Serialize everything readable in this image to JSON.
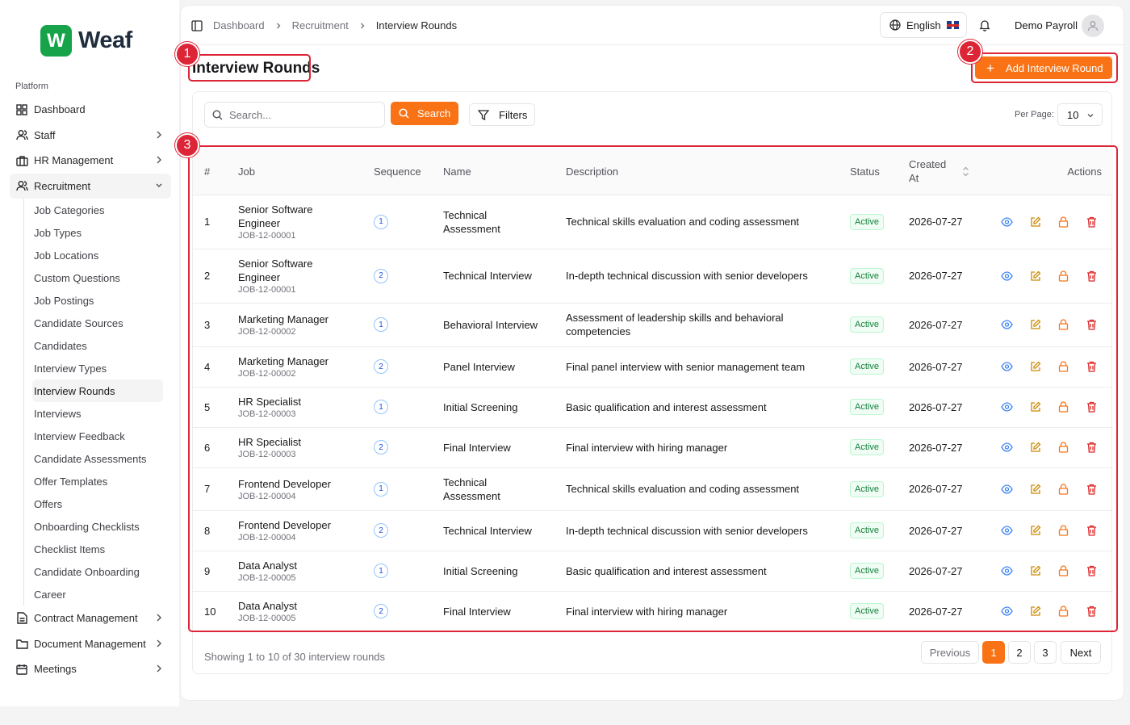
{
  "brand": {
    "logo_letter": "W",
    "name": "Weaf",
    "color": "#16a34a"
  },
  "sidebar": {
    "section_label": "Platform",
    "items": [
      {
        "label": "Dashboard",
        "icon": "grid-icon"
      },
      {
        "label": "Staff",
        "icon": "users-icon"
      },
      {
        "label": "HR Management",
        "icon": "briefcase-icon"
      },
      {
        "label": "Recruitment",
        "icon": "users-icon"
      }
    ],
    "recruitment_children": [
      "Job Categories",
      "Job Types",
      "Job Locations",
      "Custom Questions",
      "Job Postings",
      "Candidate Sources",
      "Candidates",
      "Interview Types",
      "Interview Rounds",
      "Interviews",
      "Interview Feedback",
      "Candidate Assessments",
      "Offer Templates",
      "Offers",
      "Onboarding Checklists",
      "Checklist Items",
      "Candidate Onboarding",
      "Career"
    ],
    "bottom_items": [
      {
        "label": "Contract Management",
        "icon": "file-icon"
      },
      {
        "label": "Document Management",
        "icon": "folder-icon"
      },
      {
        "label": "Meetings",
        "icon": "calendar-icon"
      }
    ]
  },
  "header": {
    "breadcrumbs": [
      "Dashboard",
      "Recruitment",
      "Interview Rounds"
    ],
    "language": "English",
    "user_name": "Demo Payroll"
  },
  "page": {
    "title": "Interview Rounds",
    "add_button": "Add Interview Round",
    "accent_color": "#f97316"
  },
  "filters": {
    "search_placeholder": "Search...",
    "search_button": "Search",
    "filters_button": "Filters",
    "per_page_label": "Per Page:",
    "per_page_value": "10"
  },
  "table": {
    "columns": {
      "idx": "#",
      "job": "Job",
      "sequence": "Sequence",
      "name": "Name",
      "description": "Description",
      "status": "Status",
      "created_line1": "Created",
      "created_line2": "At",
      "actions": "Actions"
    },
    "rows": [
      {
        "idx": "1",
        "job_line1": "Senior Software",
        "job_line2": "Engineer",
        "code": "JOB-12-00001",
        "seq": "1",
        "name_line1": "Technical",
        "name_line2": "Assessment",
        "desc_line1": "Technical skills evaluation and coding assessment",
        "desc_line2": "",
        "status": "Active",
        "created": "2026-07-27"
      },
      {
        "idx": "2",
        "job_line1": "Senior Software",
        "job_line2": "Engineer",
        "code": "JOB-12-00001",
        "seq": "2",
        "name_line1": "Technical Interview",
        "name_line2": "",
        "desc_line1": "In-depth technical discussion with senior developers",
        "desc_line2": "",
        "status": "Active",
        "created": "2026-07-27"
      },
      {
        "idx": "3",
        "job_line1": "Marketing Manager",
        "job_line2": "",
        "code": "JOB-12-00002",
        "seq": "1",
        "name_line1": "Behavioral Interview",
        "name_line2": "",
        "desc_line1": "Assessment of leadership skills and behavioral",
        "desc_line2": "competencies",
        "status": "Active",
        "created": "2026-07-27"
      },
      {
        "idx": "4",
        "job_line1": "Marketing Manager",
        "job_line2": "",
        "code": "JOB-12-00002",
        "seq": "2",
        "name_line1": "Panel Interview",
        "name_line2": "",
        "desc_line1": "Final panel interview with senior management team",
        "desc_line2": "",
        "status": "Active",
        "created": "2026-07-27"
      },
      {
        "idx": "5",
        "job_line1": "HR Specialist",
        "job_line2": "",
        "code": "JOB-12-00003",
        "seq": "1",
        "name_line1": "Initial Screening",
        "name_line2": "",
        "desc_line1": "Basic qualification and interest assessment",
        "desc_line2": "",
        "status": "Active",
        "created": "2026-07-27"
      },
      {
        "idx": "6",
        "job_line1": "HR Specialist",
        "job_line2": "",
        "code": "JOB-12-00003",
        "seq": "2",
        "name_line1": "Final Interview",
        "name_line2": "",
        "desc_line1": "Final interview with hiring manager",
        "desc_line2": "",
        "status": "Active",
        "created": "2026-07-27"
      },
      {
        "idx": "7",
        "job_line1": "Frontend Developer",
        "job_line2": "",
        "code": "JOB-12-00004",
        "seq": "1",
        "name_line1": "Technical",
        "name_line2": "Assessment",
        "desc_line1": "Technical skills evaluation and coding assessment",
        "desc_line2": "",
        "status": "Active",
        "created": "2026-07-27"
      },
      {
        "idx": "8",
        "job_line1": "Frontend Developer",
        "job_line2": "",
        "code": "JOB-12-00004",
        "seq": "2",
        "name_line1": "Technical Interview",
        "name_line2": "",
        "desc_line1": "In-depth technical discussion with senior developers",
        "desc_line2": "",
        "status": "Active",
        "created": "2026-07-27"
      },
      {
        "idx": "9",
        "job_line1": "Data Analyst",
        "job_line2": "",
        "code": "JOB-12-00005",
        "seq": "1",
        "name_line1": "Initial Screening",
        "name_line2": "",
        "desc_line1": "Basic qualification and interest assessment",
        "desc_line2": "",
        "status": "Active",
        "created": "2026-07-27"
      },
      {
        "idx": "10",
        "job_line1": "Data Analyst",
        "job_line2": "",
        "code": "JOB-12-00005",
        "seq": "2",
        "name_line1": "Final Interview",
        "name_line2": "",
        "desc_line1": "Final interview with hiring manager",
        "desc_line2": "",
        "status": "Active",
        "created": "2026-07-27"
      }
    ]
  },
  "pagination": {
    "summary": "Showing 1 to 10 of 30 interview rounds",
    "previous": "Previous",
    "pages": [
      "1",
      "2",
      "3"
    ],
    "current": "1",
    "next": "Next"
  },
  "annotations": {
    "markers": [
      "1",
      "2",
      "3"
    ],
    "color": "#dc2637"
  }
}
